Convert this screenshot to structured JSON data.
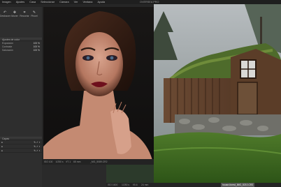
{
  "menubar": {
    "items": [
      "Imagen",
      "Ajustes",
      "Casa",
      "Seleccionar",
      "Cámara",
      "Ver",
      "Ventana",
      "Ayuda"
    ],
    "app_title": "OVERSEA PRO"
  },
  "left_panel": {
    "tools": [
      {
        "icon": "undo-icon",
        "label": "Deshacer"
      },
      {
        "icon": "pan-icon",
        "label": "Mover"
      },
      {
        "icon": "crop-icon",
        "label": "Recortar"
      },
      {
        "icon": "brush-icon",
        "label": "Pincel"
      }
    ],
    "header_label": "Ajustes de color",
    "percent_rows": [
      {
        "value": "100 %"
      },
      {
        "value": "100 %"
      },
      {
        "value": "100 %"
      }
    ],
    "row_labels": [
      "Exposición",
      "Contraste",
      "Saturación"
    ],
    "layers_header": "Capas",
    "layers": [
      "",
      "",
      ""
    ]
  },
  "viewer_left": {
    "status": [
      "ISO 100",
      "1/250 s",
      "f/7.1",
      "65 mm"
    ],
    "filename": "_MG_5089.CR2"
  },
  "viewer_right": {
    "status": [
      "ISO 1600",
      "1/250 s",
      "f/5.6",
      "24 mm"
    ],
    "filename": "house-forest_IMG_5210.CR2"
  },
  "colors": {
    "panel": "#2e2e2e",
    "background": "#2b2b2b",
    "accent": "#d0d0d0"
  }
}
